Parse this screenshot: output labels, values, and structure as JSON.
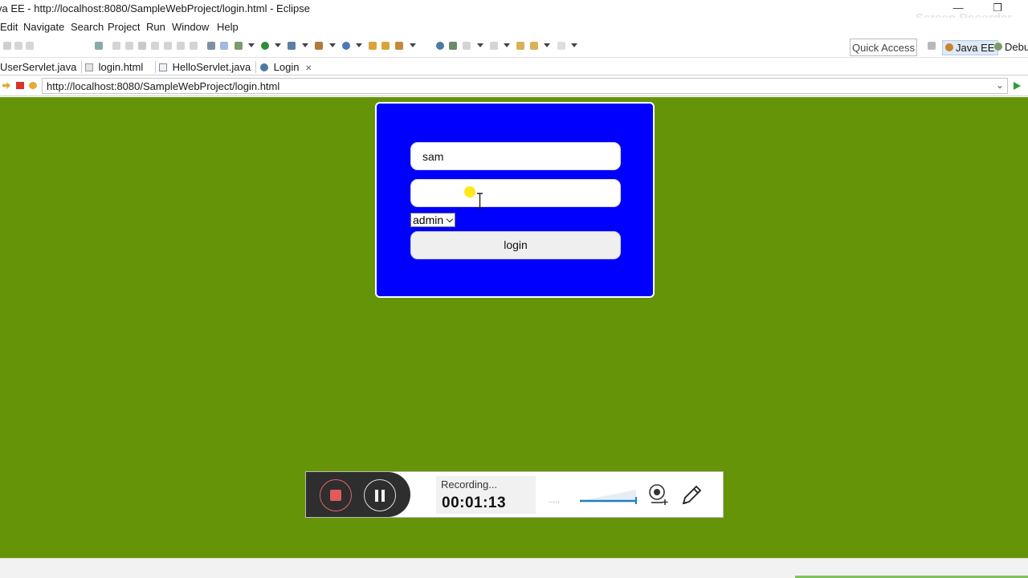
{
  "window": {
    "title": "va EE - http://localhost:8080/SampleWebProject/login.html - Eclipse",
    "watermark": "Screen Recorder"
  },
  "menu": [
    "Edit",
    "Navigate",
    "Search",
    "Project",
    "Run",
    "Window",
    "Help"
  ],
  "toolbar": {
    "quick_access": "Quick Access",
    "perspectives": [
      "Java EE",
      "Debu"
    ]
  },
  "tabs": [
    {
      "label": "UserServlet.java",
      "icon": "java-file-icon"
    },
    {
      "label": "login.html",
      "icon": "html-file-icon"
    },
    {
      "label": "HelloServlet.java",
      "icon": "java-file-icon"
    },
    {
      "label": "Login",
      "icon": "globe-icon",
      "active": true
    }
  ],
  "browser": {
    "url": "http://localhost:8080/SampleWebProject/login.html"
  },
  "login_form": {
    "username_value": "sam",
    "password_value": "",
    "role_selected": "admin",
    "submit_label": "login",
    "box_color": "#0000ff",
    "page_bg": "#669408"
  },
  "recorder": {
    "status": "Recording...",
    "elapsed": "00:01:13",
    "accent": "#e25b5b"
  }
}
